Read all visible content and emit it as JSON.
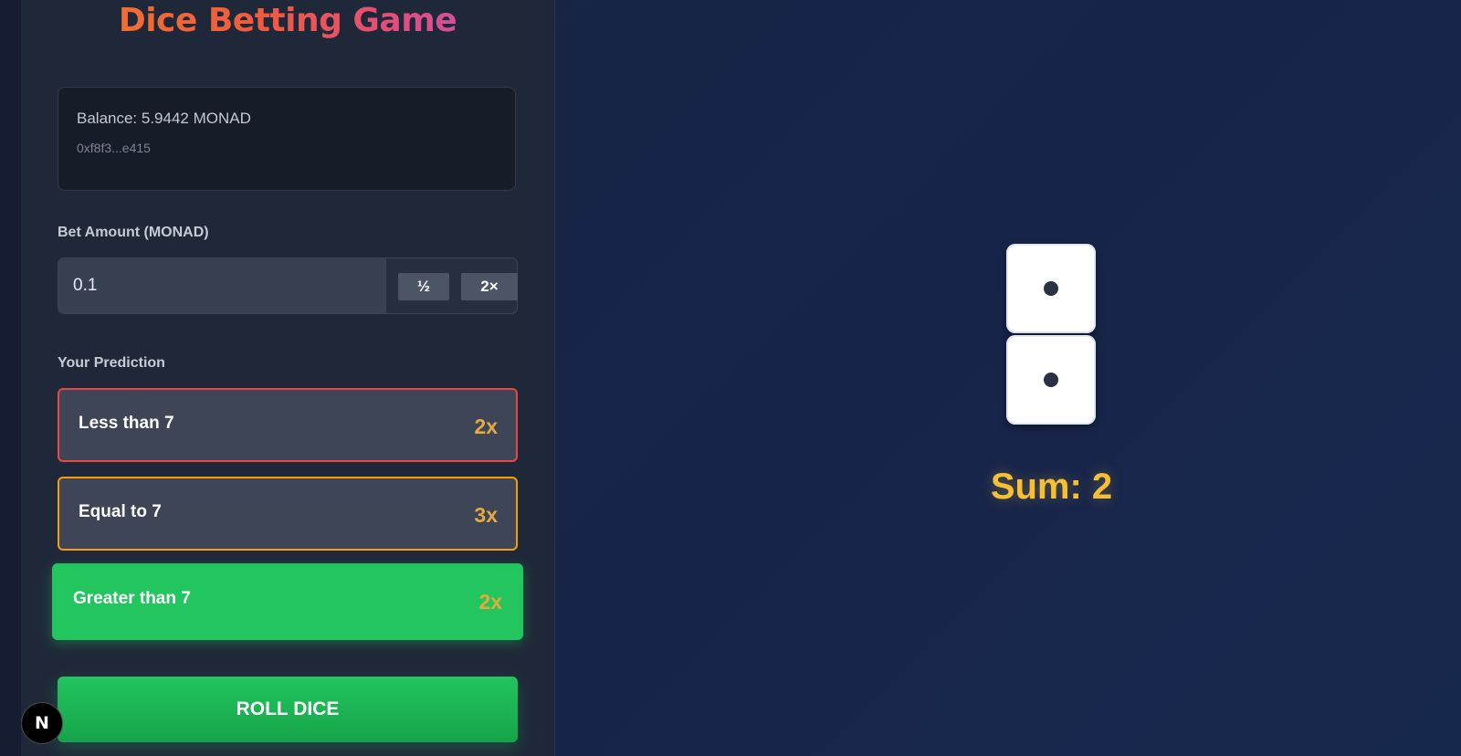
{
  "header": {
    "title": "Dice Betting Game"
  },
  "wallet": {
    "balance_text": "Balance: 5.9442 MONAD",
    "address": "0xf8f3...e415"
  },
  "bet": {
    "label": "Bet Amount (MONAD)",
    "value": "0.1",
    "half_label": "½",
    "double_label": "2×"
  },
  "prediction": {
    "label": "Your Prediction",
    "options": [
      {
        "label": "Less than 7",
        "multiplier": "2x",
        "border_color": "#ef4444",
        "selected": false
      },
      {
        "label": "Equal to 7",
        "multiplier": "3x",
        "border_color": "#f59e0b",
        "selected": false
      },
      {
        "label": "Greater than 7",
        "multiplier": "2x",
        "border_color": "#22c55e",
        "selected": true
      }
    ]
  },
  "roll_button": {
    "label": "ROLL DICE"
  },
  "badge": {
    "text": "N"
  },
  "dice": {
    "values": [
      1,
      1
    ],
    "sum_text": "Sum: 2"
  },
  "colors": {
    "accent_green": "#22c55e",
    "multiplier": "#e6a93d",
    "sum": "#f5c033"
  }
}
